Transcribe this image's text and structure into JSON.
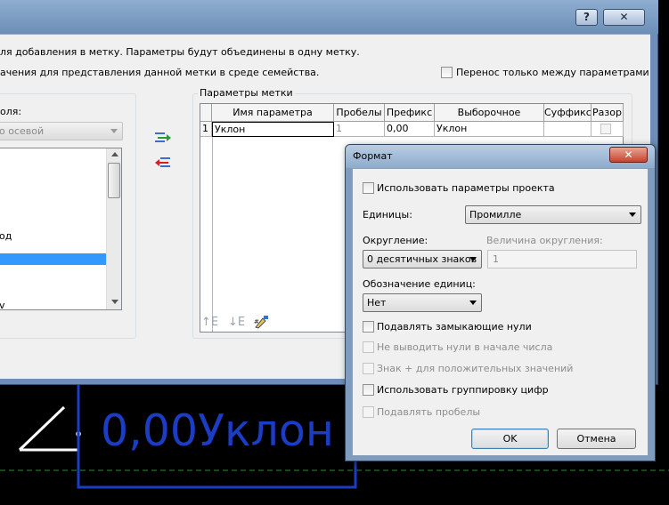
{
  "main_window": {
    "help_button": "?",
    "close_button": "✕",
    "instruction_line1": "ля добавления в метку. Параметры будут объединены в одну метку.",
    "instruction_line2": "ачения для представления данной метки в среде семейства.",
    "wrap_checkbox_label": "Перенос только между параметрами",
    "wrap_checked": false,
    "left_panel": {
      "label": "оля:",
      "category_select": "о осевой",
      "list_items": [
        "од",
        "",
        "v"
      ]
    },
    "tag_params_label": "Параметры метки",
    "table": {
      "columns": [
        "",
        "Имя параметра",
        "Пробелы",
        "Префикс",
        "Выборочное",
        "Суффикс",
        "Разор"
      ],
      "rows": [
        {
          "num": "1",
          "name": "Уклон",
          "spaces": "1",
          "prefix": "0,00",
          "sample": "Уклон",
          "suffix": "",
          "break": false
        }
      ]
    }
  },
  "tag_preview_text": "0,00Уклон",
  "format_dialog": {
    "title": "Формат",
    "close_button": "✕",
    "use_project_settings_label": "Использовать параметры проекта",
    "use_project_settings_checked": false,
    "units_label": "Единицы:",
    "units_value": "Промилле",
    "rounding_label": "Округление:",
    "rounding_value": "0 десятичных знаков",
    "rounding_increment_label": "Величина округления:",
    "rounding_increment_value": "1",
    "unit_symbol_label": "Обозначение единиц:",
    "unit_symbol_value": "Нет",
    "options": [
      {
        "label": "Подавлять замыкающие нули",
        "enabled": true,
        "checked": false
      },
      {
        "label": "Не выводить нули в начале числа",
        "enabled": false,
        "checked": false
      },
      {
        "label": "Знак + для положительных значений",
        "enabled": false,
        "checked": false
      },
      {
        "label": "Использовать группировку цифр",
        "enabled": true,
        "checked": false
      },
      {
        "label": "Подавлять пробелы",
        "enabled": false,
        "checked": false
      }
    ],
    "ok_button": "OK",
    "cancel_button": "Отмена"
  },
  "colors": {
    "tag_blue": "#1a3dc4",
    "window_frame": "#6d8fb5",
    "selection": "#3399ff",
    "close_red": "#c64530"
  }
}
